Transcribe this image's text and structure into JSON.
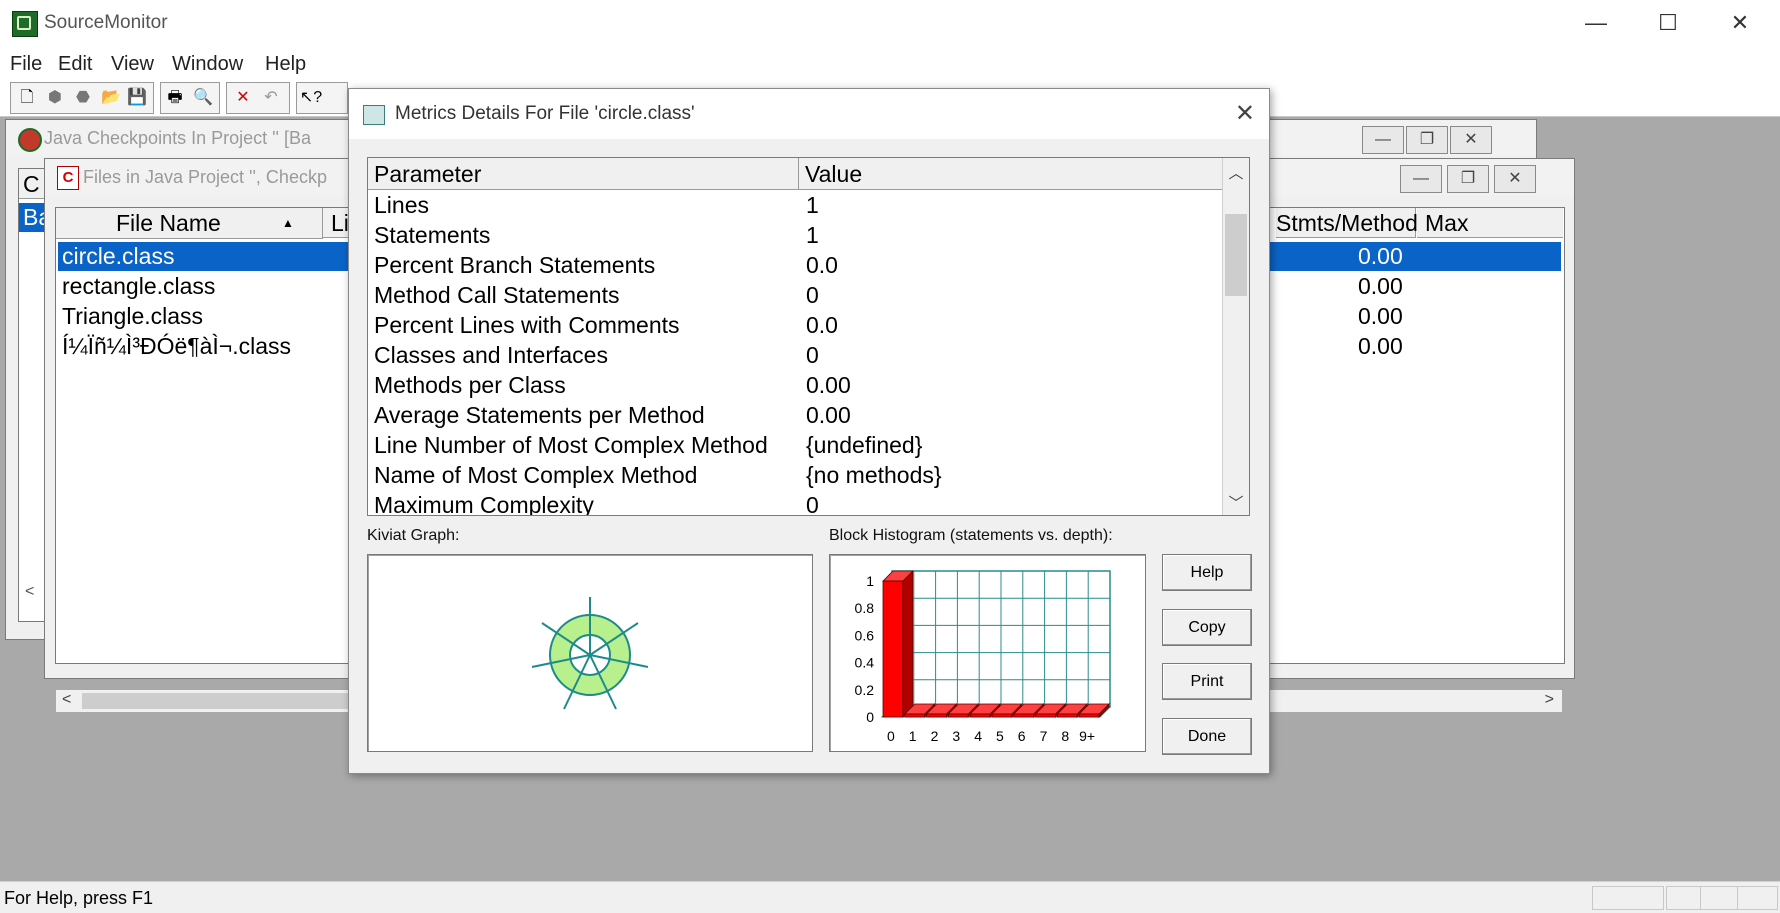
{
  "app": {
    "title": "SourceMonitor"
  },
  "window_controls": {
    "minimize": "—",
    "maximize": "☐",
    "close": "✕"
  },
  "menu": [
    "File",
    "Edit",
    "View",
    "Window",
    "Help"
  ],
  "status_bar": {
    "text": "For Help, press F1"
  },
  "checkpoints_window": {
    "title": "Java Checkpoints In Project ''  [Ba",
    "col_first": "C",
    "row_first": "Ba"
  },
  "files_window": {
    "title": "Files in Java Project '', Checkp",
    "columns": [
      "File Name",
      "Li",
      "Stmts/Method",
      "Max Complex"
    ],
    "files": [
      "circle.class",
      "rectangle.class",
      "Triangle.class",
      "Í¼Ïñ¼Ì³ÐÓë¶àÌ¬.class"
    ],
    "stmts_per_method": [
      "0.00",
      "0.00",
      "0.00",
      "0.00"
    ],
    "sort_indicator": "▲"
  },
  "dialog": {
    "title": "Metrics Details For File 'circle.class'",
    "columns": {
      "parameter": "Parameter",
      "value": "Value"
    },
    "metrics": [
      {
        "name": "Lines",
        "value": "1"
      },
      {
        "name": "Statements",
        "value": "1"
      },
      {
        "name": "Percent Branch Statements",
        "value": "0.0"
      },
      {
        "name": "Method Call Statements",
        "value": "0"
      },
      {
        "name": "Percent Lines with Comments",
        "value": "0.0"
      },
      {
        "name": "Classes and Interfaces",
        "value": "0"
      },
      {
        "name": "Methods per Class",
        "value": "0.00"
      },
      {
        "name": "Average Statements per Method",
        "value": "0.00"
      },
      {
        "name": "Line Number of Most Complex Method",
        "value": "{undefined}"
      },
      {
        "name": "Name of Most Complex Method",
        "value": "{no methods}"
      },
      {
        "name": "Maximum Complexity",
        "value": "0"
      }
    ],
    "kiviat_label": "Kiviat Graph:",
    "histogram_label": "Block Histogram (statements vs. depth):",
    "buttons": {
      "help": "Help",
      "copy": "Copy",
      "print": "Print",
      "done": "Done"
    }
  },
  "histogram": {
    "categories": [
      "0",
      "1",
      "2",
      "3",
      "4",
      "5",
      "6",
      "7",
      "8",
      "9+"
    ],
    "values": [
      1,
      0,
      0,
      0,
      0,
      0,
      0,
      0,
      0,
      0
    ],
    "y_ticks": [
      "1",
      "0.8",
      "0.6",
      "0.4",
      "0.2",
      "0"
    ],
    "ylim": [
      0,
      1
    ],
    "bar_color": "#ff0000",
    "grid_color": "#2a8c8c"
  }
}
